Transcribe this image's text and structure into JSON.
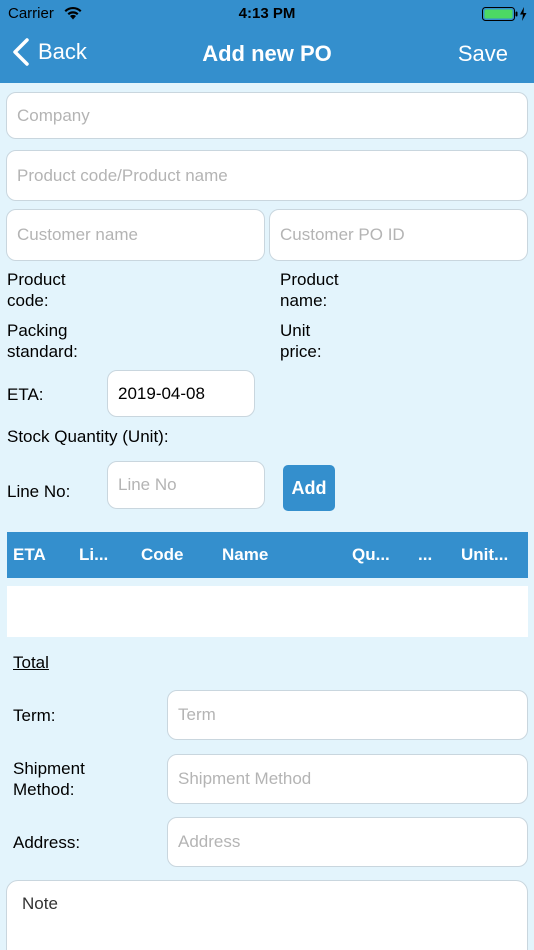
{
  "status_bar": {
    "carrier": "Carrier",
    "time": "4:13 PM",
    "icons": [
      "wifi-icon",
      "battery-icon"
    ]
  },
  "nav": {
    "back_label": "Back",
    "title": "Add new PO",
    "save_label": "Save"
  },
  "form": {
    "company_placeholder": "Company",
    "product_placeholder": "Product code/Product name",
    "customer_name_placeholder": "Customer name",
    "customer_po_placeholder": "Customer PO ID",
    "product_code_label": "Product\ncode:",
    "product_name_label": "Product\nname:",
    "packing_label": "Packing\nstandard:",
    "unit_price_label": "Unit\nprice:",
    "eta_label": "ETA:",
    "eta_value": "2019-04-08",
    "stock_label": "Stock Quantity (Unit):",
    "line_no_label": "Line No:",
    "line_no_placeholder": "Line No",
    "add_label": "Add"
  },
  "table": {
    "columns": [
      "ETA",
      "Li...",
      "Code",
      "Name",
      "Qu...",
      "...",
      "Unit..."
    ]
  },
  "summary": {
    "total_label": "Total",
    "term_label": "Term:",
    "term_placeholder": "Term",
    "shipment_label": "Shipment\nMethod:",
    "shipment_placeholder": "Shipment Method",
    "address_label": "Address:",
    "address_placeholder": "Address",
    "note_placeholder": "Note"
  },
  "colors": {
    "accent": "#348fcd",
    "background": "#e3f4fc",
    "battery": "#4cd964"
  }
}
